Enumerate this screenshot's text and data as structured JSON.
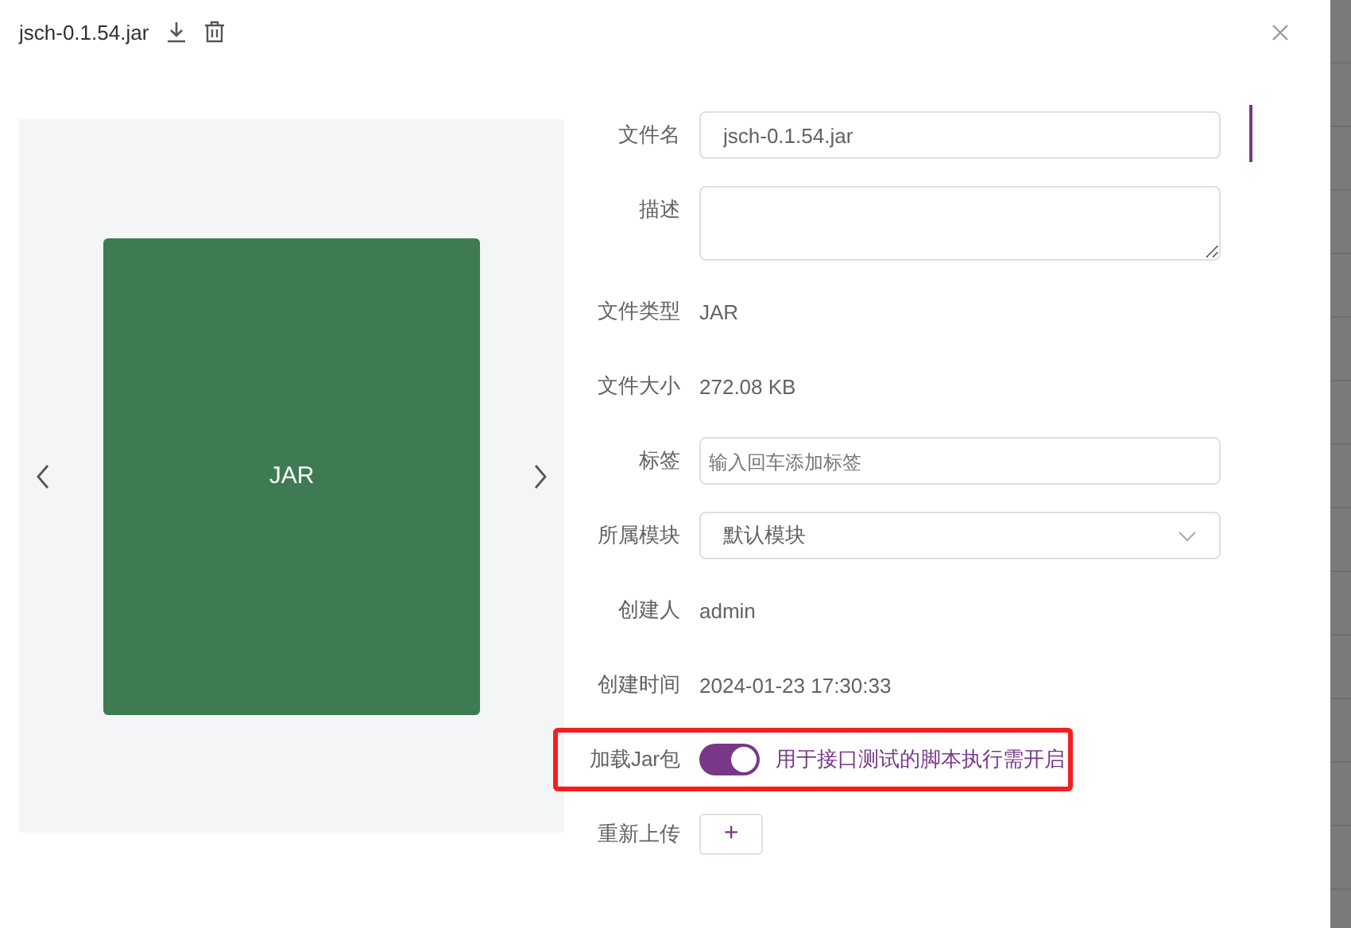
{
  "dialog": {
    "title": "jsch-0.1.54.jar"
  },
  "preview": {
    "card_text": "JAR"
  },
  "form": [
    {
      "kind": "input",
      "label": "文件名",
      "value": "jsch-0.1.54.jar"
    },
    {
      "kind": "textarea",
      "label": "描述"
    },
    {
      "kind": "text",
      "label": "文件类型",
      "value": "JAR"
    },
    {
      "kind": "text",
      "label": "文件大小",
      "value": "272.08 KB"
    },
    {
      "kind": "input",
      "label": "标签",
      "placeholder": "输入回车添加标签"
    },
    {
      "kind": "select",
      "label": "所属模块",
      "value": "默认模块"
    },
    {
      "kind": "text",
      "label": "创建人",
      "value": "admin"
    },
    {
      "kind": "text",
      "label": "创建时间",
      "value": "2024-01-23 17:30:33"
    },
    {
      "kind": "switch",
      "label": "加载Jar包",
      "on": true,
      "hint": "用于接口测试的脚本执行需开启",
      "highlighted": true
    },
    {
      "kind": "upload",
      "label": "重新上传",
      "button": "+"
    }
  ]
}
